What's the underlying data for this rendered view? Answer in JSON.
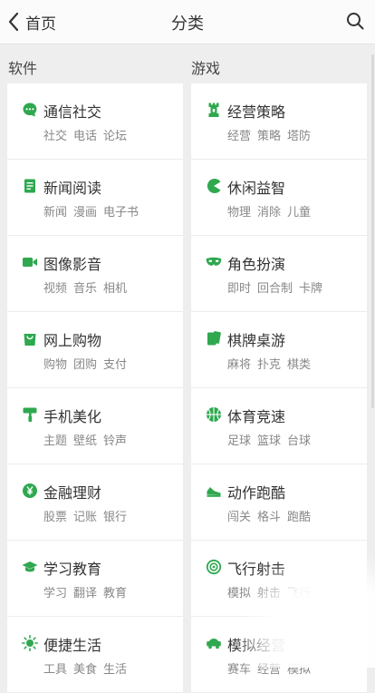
{
  "header": {
    "back_label": "首页",
    "title": "分类"
  },
  "columns": {
    "software": "软件",
    "games": "游戏"
  },
  "accent": "#2fa84f",
  "software": [
    {
      "name": "通信社交",
      "subs": [
        "社交",
        "电话",
        "论坛"
      ],
      "icon": "chat-bubble-icon"
    },
    {
      "name": "新闻阅读",
      "subs": [
        "新闻",
        "漫画",
        "电子书"
      ],
      "icon": "document-icon"
    },
    {
      "name": "图像影音",
      "subs": [
        "视频",
        "音乐",
        "相机"
      ],
      "icon": "video-camera-icon"
    },
    {
      "name": "网上购物",
      "subs": [
        "购物",
        "团购",
        "支付"
      ],
      "icon": "shopping-bag-icon"
    },
    {
      "name": "手机美化",
      "subs": [
        "主题",
        "壁纸",
        "铃声"
      ],
      "icon": "paint-roller-icon"
    },
    {
      "name": "金融理财",
      "subs": [
        "股票",
        "记账",
        "银行"
      ],
      "icon": "yen-coin-icon"
    },
    {
      "name": "学习教育",
      "subs": [
        "学习",
        "翻译",
        "教育"
      ],
      "icon": "graduation-cap-icon"
    },
    {
      "name": "便捷生活",
      "subs": [
        "工具",
        "美食",
        "生活"
      ],
      "icon": "sun-icon"
    }
  ],
  "games": [
    {
      "name": "经营策略",
      "subs": [
        "经营",
        "策略",
        "塔防"
      ],
      "icon": "rook-tower-icon"
    },
    {
      "name": "休闲益智",
      "subs": [
        "物理",
        "消除",
        "儿童"
      ],
      "icon": "pacman-icon"
    },
    {
      "name": "角色扮演",
      "subs": [
        "即时",
        "回合制",
        "卡牌"
      ],
      "icon": "mask-icon"
    },
    {
      "name": "棋牌桌游",
      "subs": [
        "麻将",
        "扑克",
        "棋类"
      ],
      "icon": "cards-icon"
    },
    {
      "name": "体育竞速",
      "subs": [
        "足球",
        "篮球",
        "台球"
      ],
      "icon": "basketball-icon"
    },
    {
      "name": "动作跑酷",
      "subs": [
        "闯关",
        "格斗",
        "跑酷"
      ],
      "icon": "sneaker-icon"
    },
    {
      "name": "飞行射击",
      "subs": [
        "模拟",
        "射击",
        "飞行"
      ],
      "icon": "target-icon"
    },
    {
      "name": "模拟经营",
      "subs": [
        "赛车",
        "经营",
        "模拟"
      ],
      "icon": "car-icon"
    }
  ]
}
